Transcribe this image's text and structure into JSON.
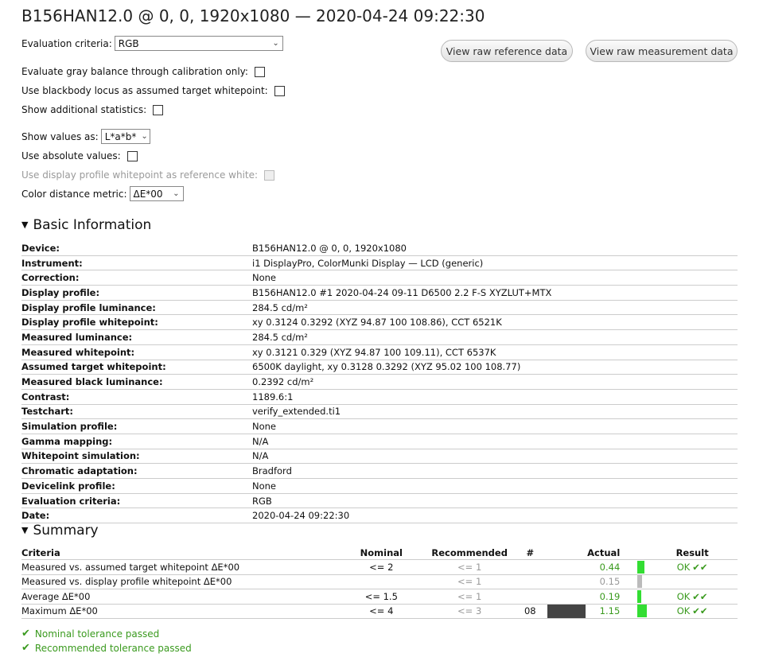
{
  "title": "B156HAN12.0 @ 0, 0, 1920x1080 — 2020-04-24 09:22:30",
  "options": {
    "evaluation_label": "Evaluation criteria:",
    "evaluation_value": "RGB",
    "gray_balance_label": "Evaluate gray balance through calibration only:",
    "blackbody_label": "Use blackbody locus as assumed target whitepoint:",
    "additional_stats_label": "Show additional statistics:",
    "show_values_label": "Show values as:",
    "show_values_value": "L*a*b*",
    "absolute_label": "Use absolute values:",
    "profile_white_label": "Use display profile whitepoint as reference white:",
    "distance_label": "Color distance metric:",
    "distance_value": "ΔE*00"
  },
  "buttons": {
    "reference": "View raw reference data",
    "measurement": "View raw measurement data"
  },
  "basic": {
    "heading": "Basic Information",
    "rows": [
      {
        "k": "Device:",
        "v": "B156HAN12.0 @ 0, 0, 1920x1080"
      },
      {
        "k": "Instrument:",
        "v": "i1 DisplayPro, ColorMunki Display — LCD (generic)"
      },
      {
        "k": "Correction:",
        "v": "None"
      },
      {
        "k": "Display profile:",
        "v": "B156HAN12.0 #1 2020-04-24 09-11 D6500 2.2 F-S XYZLUT+MTX"
      },
      {
        "k": "Display profile luminance:",
        "v": "284.5 cd/m²"
      },
      {
        "k": "Display profile whitepoint:",
        "v": "xy 0.3124 0.3292 (XYZ 94.87 100 108.86), CCT 6521K"
      },
      {
        "k": "Measured luminance:",
        "v": "284.5 cd/m²"
      },
      {
        "k": "Measured whitepoint:",
        "v": "xy 0.3121 0.329 (XYZ 94.87 100 109.11), CCT 6537K"
      },
      {
        "k": "Assumed target whitepoint:",
        "v": "6500K daylight, xy 0.3128 0.3292 (XYZ 95.02 100 108.77)"
      },
      {
        "k": "Measured black luminance:",
        "v": "0.2392 cd/m²"
      },
      {
        "k": "Contrast:",
        "v": "1189.6:1"
      },
      {
        "k": "Testchart:",
        "v": "verify_extended.ti1"
      },
      {
        "k": "Simulation profile:",
        "v": "None"
      },
      {
        "k": "Gamma mapping:",
        "v": "N/A"
      },
      {
        "k": "Whitepoint simulation:",
        "v": "N/A"
      },
      {
        "k": "Chromatic adaptation:",
        "v": "Bradford"
      },
      {
        "k": "Devicelink profile:",
        "v": "None"
      },
      {
        "k": "Evaluation criteria:",
        "v": "RGB"
      },
      {
        "k": "Date:",
        "v": "2020-04-24 09:22:30"
      }
    ]
  },
  "summary": {
    "heading": "Summary",
    "headers": {
      "criteria": "Criteria",
      "nominal": "Nominal",
      "recommended": "Recommended",
      "num": "#",
      "actual": "Actual",
      "result": "Result"
    },
    "rows": [
      {
        "criteria": "Measured vs. assumed target whitepoint ΔE*00",
        "nominal": "<= 2",
        "recommended": "<= 1",
        "num": "",
        "actual": "0.44",
        "bar_level": 0.22,
        "bar_color": "#33dd33",
        "result": "OK",
        "checks": "✔✔"
      },
      {
        "criteria": "Measured vs. display profile whitepoint ΔE*00",
        "nominal": "",
        "recommended": "<= 1",
        "num": "",
        "actual": "0.15",
        "bar_level": 0.15,
        "bar_color": "#bbbbbb",
        "result": "",
        "checks": ""
      },
      {
        "criteria": "Average ΔE*00",
        "nominal": "<= 1.5",
        "recommended": "<= 1",
        "num": "",
        "actual": "0.19",
        "bar_level": 0.13,
        "bar_color": "#33dd33",
        "result": "OK",
        "checks": "✔✔"
      },
      {
        "criteria": "Maximum ΔE*00",
        "nominal": "<= 4",
        "recommended": "<= 3",
        "num": "08",
        "actual": "1.15",
        "bar_level": 0.29,
        "bar_color": "#33dd33",
        "result": "OK",
        "checks": "✔✔"
      }
    ]
  },
  "footer": {
    "nominal_passed": "Nominal tolerance passed",
    "recommended_passed": "Recommended tolerance passed"
  },
  "colors": {
    "ok_green": "#3a9a1e",
    "bar_green": "#33dd33",
    "patch": "#444444"
  }
}
